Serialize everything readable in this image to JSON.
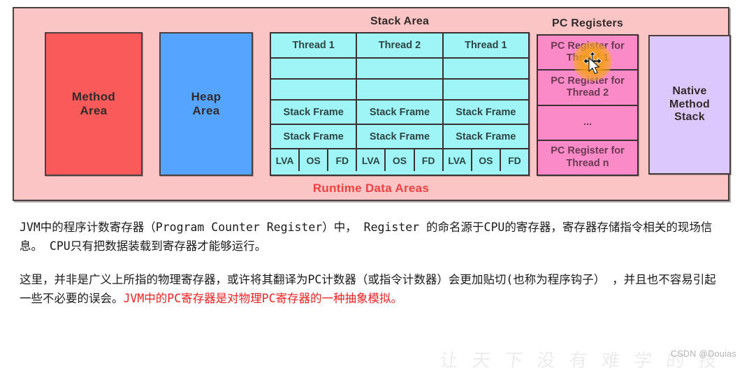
{
  "diagram": {
    "method_area": "Method\nArea",
    "heap_area": "Heap\nArea",
    "stack_area_title": "Stack Area",
    "pc_registers_title": "PC Registers",
    "native_method_stack": "Native\nMethod\nStack",
    "runtime_label": "Runtime Data Areas",
    "stack_columns": [
      {
        "thread": "Thread 1",
        "empty1": "",
        "empty2": "",
        "frame1": "Stack Frame",
        "frame2": "Stack Frame",
        "parts": [
          "LVA",
          "OS",
          "FD"
        ]
      },
      {
        "thread": "Thread 2",
        "empty1": "",
        "empty2": "",
        "frame1": "Stack Frame",
        "frame2": "Stack Frame",
        "parts": [
          "LVA",
          "OS",
          "FD"
        ]
      },
      {
        "thread": "Thread 1",
        "empty1": "",
        "empty2": "",
        "frame1": "Stack Frame",
        "frame2": "Stack Frame",
        "parts": [
          "LVA",
          "OS",
          "FD"
        ]
      }
    ],
    "pc_registers": [
      "PC Register for Thread 1",
      "PC Register for Thread 2",
      "...",
      "PC Register for Thread n"
    ],
    "colors": {
      "background": "#fbc5c5",
      "method_area": "#fa5a5a",
      "heap_area": "#55a5ff",
      "stack_area": "#9ff5f5",
      "pc_registers": "#fa8ac8",
      "native_method_stack": "#ddc8fb",
      "runtime_label": "#ef4141",
      "cursor_highlight": "#f7a014"
    }
  },
  "text": {
    "paragraph1_part1": "JVM中的程序计数寄存器（Program Counter Register）中， Register 的命名源于CPU的寄存器，寄存器存储指令相关的现场信息。 CPU只有把数据装载到寄存器才能够运行。",
    "paragraph2_part1": "这里，并非是广义上所指的物理寄存器，或许将其翻译为PC计数器（或指令计数器）会更加贴切(也称为程序钩子） ，并且也不容易引起一些不必要的误会。",
    "paragraph2_highlight": "JVM中的PC寄存器是对物理PC寄存器的一种抽象模拟。"
  },
  "watermark": {
    "csdn": "CSDN @Douias",
    "brush": "让 天 下 没 有 难 学 的 技 术"
  }
}
